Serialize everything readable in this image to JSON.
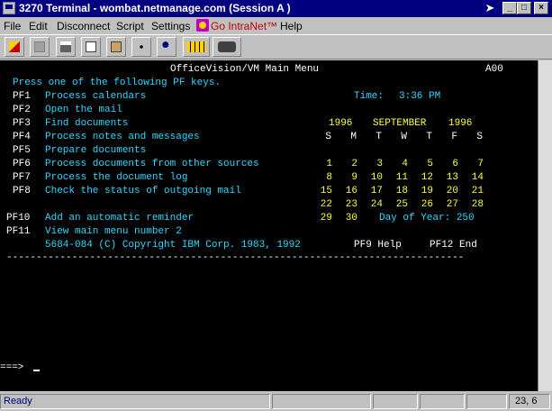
{
  "window": {
    "title": "3270 Terminal - wombat.netmanage.com (Session A )"
  },
  "menu": {
    "file": "File",
    "edit": "Edit",
    "disconnect": "Disconnect",
    "script": "Script",
    "settings": "Settings",
    "gointranet": "Go IntraNet™",
    "help": "Help"
  },
  "toolbar": {
    "icons": [
      "connect-icon",
      "save-icon",
      "print-icon",
      "copy-icon",
      "paste-icon",
      "network-icon",
      "run-icon",
      "grid-icon",
      "camera-icon"
    ]
  },
  "screen": {
    "header": "OfficeVision/VM Main Menu",
    "screen_id": "A00",
    "instruction": "Press one of the following PF keys.",
    "time_label": "Time:",
    "time_value": "3:36 PM",
    "options": [
      {
        "key": "PF1",
        "text": "Process calendars"
      },
      {
        "key": "PF2",
        "text": "Open the mail"
      },
      {
        "key": "PF3",
        "text": "Find documents"
      },
      {
        "key": "PF4",
        "text": "Process notes and messages"
      },
      {
        "key": "PF5",
        "text": "Prepare documents"
      },
      {
        "key": "PF6",
        "text": "Process documents from other sources"
      },
      {
        "key": "PF7",
        "text": "Process the document log"
      },
      {
        "key": "PF8",
        "text": "Check the status of outgoing mail"
      },
      {
        "key": "PF10",
        "text": "Add an automatic reminder"
      },
      {
        "key": "PF11",
        "text": "View main menu number 2"
      }
    ],
    "calendar": {
      "year_left": "1996",
      "month": "SEPTEMBER",
      "year_right": "1996",
      "days": [
        "S",
        "M",
        "T",
        "W",
        "T",
        "F",
        "S"
      ],
      "weeks": [
        [
          "1",
          "2",
          "3",
          "4",
          "5",
          "6",
          "7"
        ],
        [
          "8",
          "9",
          "10",
          "11",
          "12",
          "13",
          "14"
        ],
        [
          "15",
          "16",
          "17",
          "18",
          "19",
          "20",
          "21"
        ],
        [
          "22",
          "23",
          "24",
          "25",
          "26",
          "27",
          "28"
        ],
        [
          "29",
          "30",
          "",
          "",
          "",
          "",
          ""
        ]
      ]
    },
    "day_of_year": "Day of Year: 250",
    "copyright": "5684-084 (C) Copyright IBM Corp. 1983, 1992",
    "pf9": "PF9 Help",
    "pf12": "PF12 End",
    "separator": "-----------------------------------------------------------------------------",
    "prompt": "===>"
  },
  "status": {
    "ready": "Ready",
    "position": "23, 6"
  }
}
